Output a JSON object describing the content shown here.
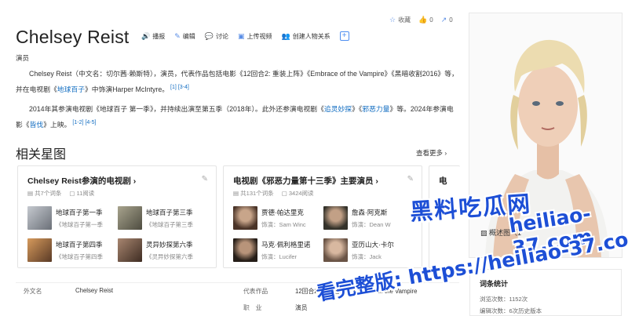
{
  "top_actions": {
    "collect": "收藏",
    "likes": "0",
    "shares": "0"
  },
  "title": "Chelsey Reist",
  "title_actions": [
    "播报",
    "编辑",
    "讨论",
    "上传视频",
    "创建人物关系"
  ],
  "role": "演员",
  "para1": {
    "a": "Chelsey Reist（中文名：切尔茜·赖斯特），演员，代表作品包括电影《12回合2: 重装上阵》《Embrace of the Vampire》《黑暗收割2016》等，并在电视剧《",
    "link": "地球百子",
    "b": "》中饰演Harper McIntyre。",
    "ref1": "[1]",
    "ref2": "[3-4]"
  },
  "para2": {
    "a": "2014年其参演电视剧《地球百子 第一季》，并持续出演至第五季（2018年）。此外还参演电视剧《",
    "link1": "追灵妙探",
    "b": "》《",
    "link2": "邪恶力量",
    "c": "》等。2024年参演电影《",
    "link3": "皆伐",
    "d": "》上映。",
    "ref1": "[1-2]",
    "ref2": "[4-5]"
  },
  "section": {
    "title": "相关星图",
    "see_more": "查看更多 ›"
  },
  "card1": {
    "title": "Chelsey Reist参演的电视剧 ›",
    "count": "共7个词条",
    "reads": "11阅读",
    "items": [
      {
        "name": "地球百子第一季",
        "sub": "《地球百子第一季",
        "color": "#8a8e96"
      },
      {
        "name": "地球百子第三季",
        "sub": "《地球百子第三季",
        "color": "#6b6a5a"
      },
      {
        "name": "地球百子第四季",
        "sub": "《地球百子第四季",
        "color": "#b07a4a"
      },
      {
        "name": "灵异妙探第六季",
        "sub": "《灵异妙探第六季",
        "color": "#7a5a48"
      }
    ]
  },
  "card2": {
    "title": "电视剧《邪恶力量第十三季》主要演员 ›",
    "count": "共131个词条",
    "reads": "3424阅读",
    "items": [
      {
        "name": "贾德·帕达里克",
        "sub": "饰演：Sam Winc",
        "color": "#6b5040"
      },
      {
        "name": "詹森·阿克斯",
        "sub": "饰演：Dean W",
        "color": "#4a4a40"
      },
      {
        "name": "马克·佩利格里诺",
        "sub": "饰演：Lucifer",
        "color": "#3a3028"
      },
      {
        "name": "亚历山大·卡尔",
        "sub": "饰演：Jack",
        "color": "#8a7060"
      }
    ]
  },
  "card3": {
    "title": "电"
  },
  "info": {
    "label1": "外文名",
    "value1": "Chelsey Reist",
    "label2": "代表作品",
    "value2": "12回合2: 重装上阵、Embrace of the Vampire",
    "label3": "职　业",
    "value3": "演员"
  },
  "album_label": "概述图（1",
  "stats": {
    "title": "词条统计",
    "views": "浏览次数：1152次",
    "edits": "编辑次数：6次历史版本"
  },
  "watermarks": {
    "w1": "黑料吃瓜网",
    "w2": "heiliao-37.com",
    "w3": "看完整版: https://heiliao-37.com"
  }
}
